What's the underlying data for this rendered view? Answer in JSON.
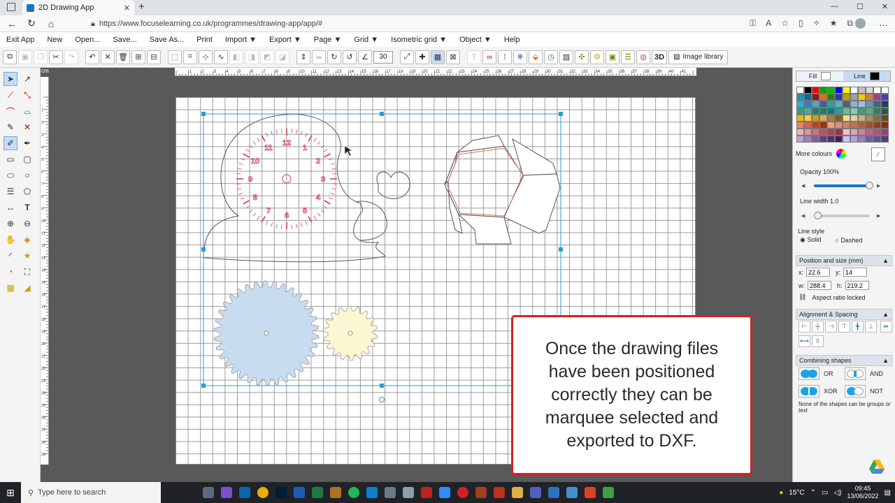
{
  "browser": {
    "tab_title": "2D Drawing App",
    "url": "https://www.focuselearning.co.uk/programmes/drawing-app/app/#"
  },
  "menu": [
    "Exit App",
    "New",
    "Open...",
    "Save...",
    "Save As...",
    "Print",
    "Import ▼",
    "Export ▼",
    "Page ▼",
    "Grid ▼",
    "Isometric grid ▼",
    "Object ▼",
    "Help"
  ],
  "toolbar": {
    "zoom_value": "30",
    "btn_3d": "3D",
    "image_library": "Image library"
  },
  "ruler": {
    "unit": "cm",
    "h_ticks": [
      "1",
      "2",
      "3",
      "4",
      "5",
      "6",
      "7",
      "8",
      "9",
      "10",
      "11",
      "12",
      "13",
      "14",
      "15",
      "16",
      "17",
      "18",
      "19",
      "20",
      "21",
      "22",
      "23",
      "24",
      "25",
      "26",
      "27",
      "28",
      "29",
      "30",
      "31",
      "32",
      "33",
      "34",
      "35",
      "36",
      "37",
      "38",
      "39",
      "40",
      "41",
      "42"
    ],
    "v_ticks": [
      "1",
      "2",
      "3",
      "4",
      "5",
      "6",
      "7",
      "8",
      "9",
      "10",
      "11",
      "12",
      "13",
      "14",
      "15",
      "16",
      "17",
      "18",
      "19",
      "20",
      "21",
      "22",
      "23",
      "24",
      "25",
      "26",
      "27",
      "28",
      "29"
    ]
  },
  "clock_numbers": [
    "12",
    "1",
    "2",
    "3",
    "4",
    "5",
    "6",
    "7",
    "8",
    "9",
    "10",
    "11"
  ],
  "callout_text": "Once the drawing files have been positioned correctly they can be marquee selected and exported to DXF.",
  "panel": {
    "fill_label": "Fill",
    "line_label": "Line",
    "more_colours": "More colours",
    "opacity_label": "Opacity 100%",
    "opacity_value": 100,
    "line_width_label": "Line width 1.0",
    "line_width_value": 1.0,
    "line_style_label": "Line style",
    "solid_label": "Solid",
    "dashed_label": "Dashed",
    "position_header": "Position and size (mm)",
    "x_label": "x:",
    "x_value": "22.6",
    "y_label": "y:",
    "y_value": "14",
    "w_label": "w:",
    "w_value": "288.4",
    "h_label": "h:",
    "h_value": "219.2",
    "aspect_label": "Aspect ratio locked",
    "alignment_header": "Alignment & Spacing",
    "combining_header": "Combining shapes",
    "or_label": "OR",
    "and_label": "AND",
    "xor_label": "XOR",
    "not_label": "NOT",
    "combining_note": "None of the shapes can be groups or text",
    "palette": [
      "#ffffff",
      "#000000",
      "#ff0000",
      "#00aa00",
      "#00c000",
      "#0000ff",
      "#ffff00",
      "#ffffff",
      "#c0c0c0",
      "#d8d8d8",
      "#ffffff",
      "#ffffff",
      "#1a8fd0",
      "#0a6a9a",
      "#8b1a1a",
      "#e07020",
      "#208020",
      "#2040a0",
      "#c0a000",
      "#a0a0a0",
      "#f0d000",
      "#d08040",
      "#a04080",
      "#4040c0",
      "#2ab0e0",
      "#3080c0",
      "#60a0c0",
      "#4060a0",
      "#30a0a0",
      "#40c0c0",
      "#506070",
      "#90b0d0",
      "#a0c0e0",
      "#7090b0",
      "#406080",
      "#204060",
      "#30a080",
      "#40b090",
      "#20806a",
      "#208060",
      "#008080",
      "#20a0a0",
      "#60c0a0",
      "#80d0b0",
      "#3aa070",
      "#50b080",
      "#308060",
      "#206040",
      "#e0c000",
      "#f0d040",
      "#c0a020",
      "#d0b060",
      "#a08040",
      "#806020",
      "#f0e080",
      "#e0d0a0",
      "#c0b080",
      "#a09060",
      "#807040",
      "#605020",
      "#f08060",
      "#e06040",
      "#c04020",
      "#a03010",
      "#f0a080",
      "#e09070",
      "#d08060",
      "#c07050",
      "#b06040",
      "#a05030",
      "#904020",
      "#803010",
      "#f0b0c0",
      "#e090a0",
      "#d07080",
      "#c05060",
      "#b04050",
      "#a03040",
      "#f0c0d0",
      "#e0a0b0",
      "#d080a0",
      "#c06090",
      "#b05080",
      "#a04070",
      "#c0a0e0",
      "#a080c0",
      "#8060a0",
      "#604080",
      "#503070",
      "#402060",
      "#d0c0f0",
      "#b0a0e0",
      "#9080c0",
      "#7060a0",
      "#605090",
      "#504080"
    ]
  },
  "taskbar": {
    "search_placeholder": "Type here to search",
    "temperature": "15°C",
    "time": "09:45",
    "date": "13/06/2022"
  }
}
